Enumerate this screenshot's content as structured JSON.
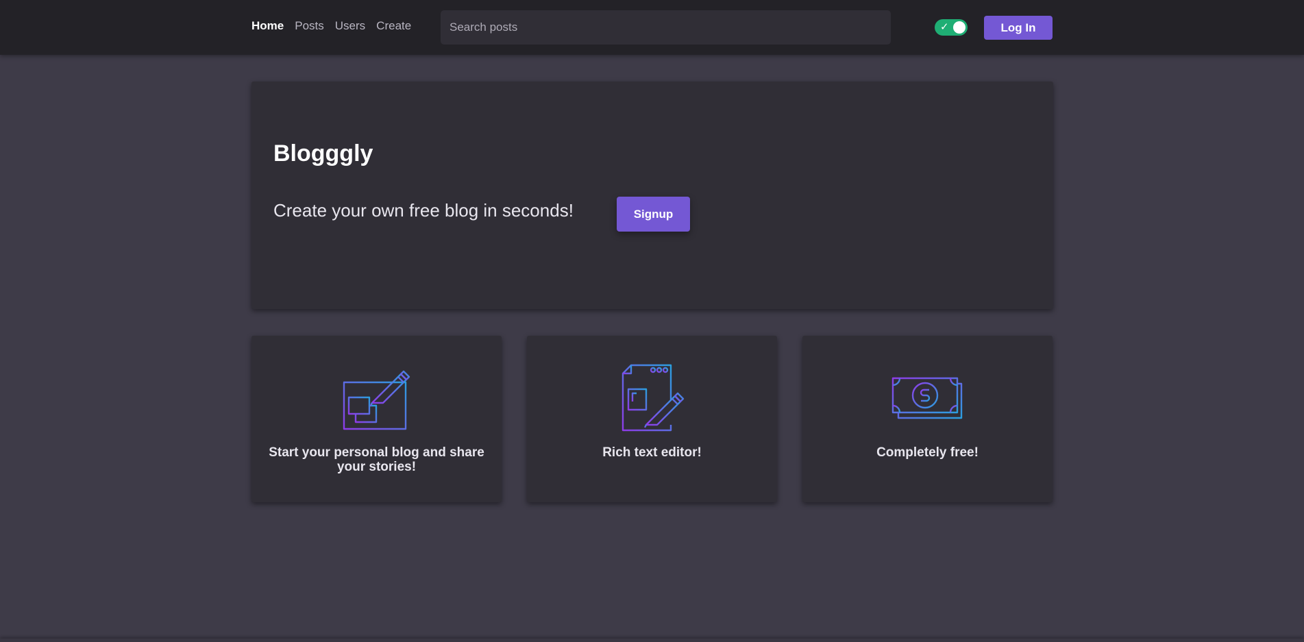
{
  "nav": {
    "links": [
      {
        "label": "Home",
        "active": true
      },
      {
        "label": "Posts",
        "active": false
      },
      {
        "label": "Users",
        "active": false
      },
      {
        "label": "Create",
        "active": false
      }
    ],
    "search_placeholder": "Search posts",
    "theme_toggle": {
      "checked": true,
      "icon": "checkmark-icon",
      "color": "#1fae74"
    },
    "login_label": "Log In"
  },
  "hero": {
    "title": "Blogggly",
    "tagline": "Create your own free blog in seconds!",
    "signup_label": "Signup"
  },
  "features": [
    {
      "icon": "blog-writing-icon",
      "text": "Start your personal blog and share your stories!"
    },
    {
      "icon": "document-edit-icon",
      "text": "Rich text editor!"
    },
    {
      "icon": "money-bill-icon",
      "text": "Completely free!"
    }
  ],
  "colors": {
    "accent": "#7458d4",
    "navbar": "#232227",
    "background": "#3e3b48",
    "card": "#302e36",
    "icon_gradient_start": "#8e3ce8",
    "icon_gradient_end": "#2b9fe0"
  }
}
